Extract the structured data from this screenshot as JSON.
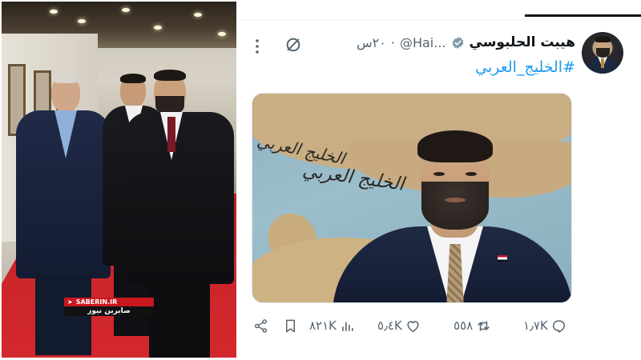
{
  "photo": {
    "watermark_site": "SABERIN.IR",
    "watermark_name": "صابرين نيوز"
  },
  "tweet": {
    "display_name": "هيبت الحلبوسي",
    "handle": "@Hai...",
    "timestamp": "٢٠س",
    "separator": "·",
    "hashtag": "#الخليج_العربي",
    "map_script_1": "الخليج العربي",
    "map_script_2": "الخليج العربي",
    "stats": {
      "replies": "١٫٧K",
      "reposts": "٥٥٨",
      "likes": "٥٫٤K",
      "views": "٨٢١K"
    }
  },
  "colors": {
    "accent": "#1d9bf0",
    "muted": "#536471",
    "carpet": "#c9252a",
    "watermark_red": "#c8181e"
  },
  "icons": [
    "verified-badge-icon",
    "grok-icon",
    "more-icon",
    "reply-icon",
    "repost-icon",
    "like-icon",
    "views-icon",
    "bookmark-icon",
    "share-icon"
  ]
}
